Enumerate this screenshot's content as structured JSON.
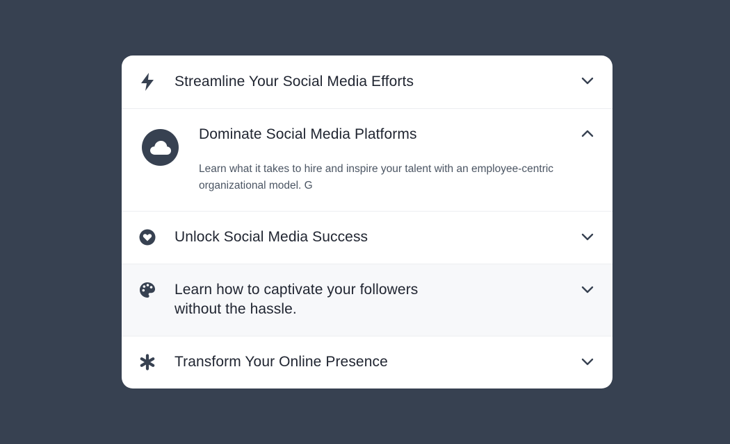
{
  "accordion": {
    "items": [
      {
        "title": "Streamline Your Social Media Efforts",
        "icon": "bolt-icon",
        "expanded": false
      },
      {
        "title": "Dominate Social Media Platforms",
        "icon": "cloud-icon",
        "expanded": true,
        "description": "Learn what it takes to hire and inspire your talent with an employee-centric organizational model. G"
      },
      {
        "title": "Unlock Social Media Success",
        "icon": "heart-icon",
        "expanded": false
      },
      {
        "title": "Learn how to captivate your followers without the hassle.",
        "icon": "palette-icon",
        "expanded": false
      },
      {
        "title": "Transform Your Online Presence",
        "icon": "asterisk-icon",
        "expanded": false
      }
    ]
  },
  "colors": {
    "background": "#374151",
    "card": "#ffffff",
    "text": "#1f2430",
    "muted_text": "#4b5563",
    "icon": "#374151",
    "hover_row": "#f7f8fa"
  }
}
